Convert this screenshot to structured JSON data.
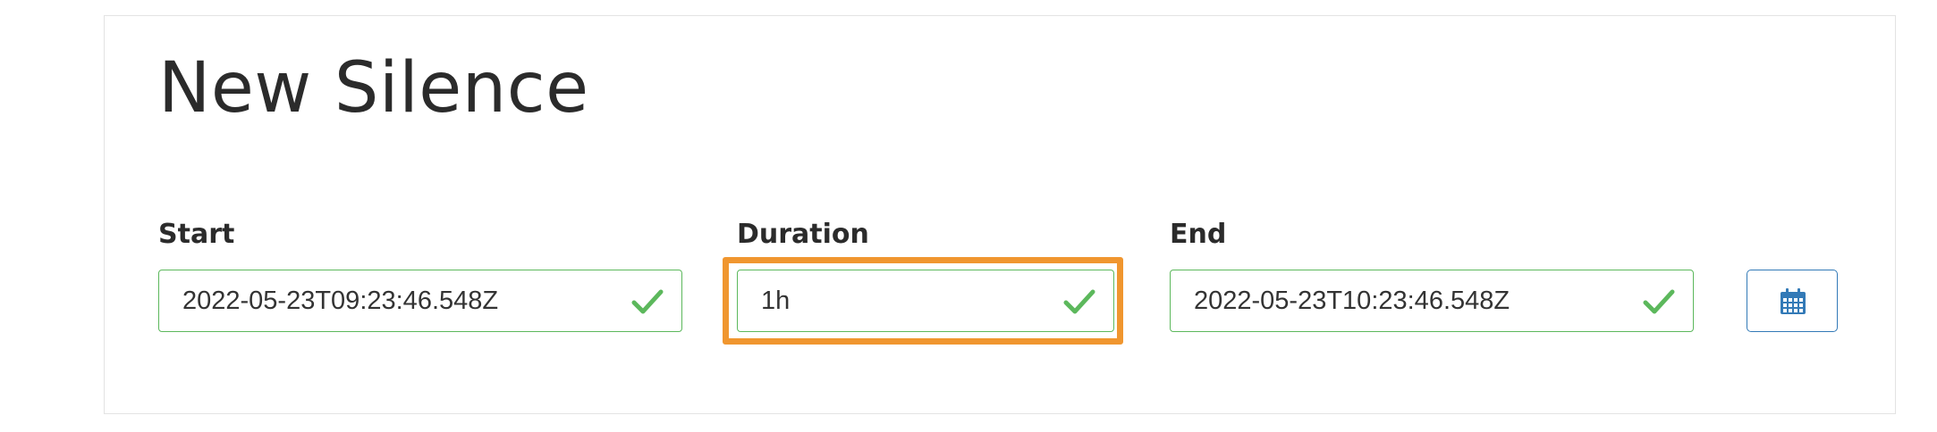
{
  "title": "New Silence",
  "fields": {
    "start": {
      "label": "Start",
      "value": "2022-05-23T09:23:46.548Z"
    },
    "duration": {
      "label": "Duration",
      "value": "1h"
    },
    "end": {
      "label": "End",
      "value": "2022-05-23T10:23:46.548Z"
    }
  },
  "icons": {
    "valid": "check-icon",
    "picker": "calendar-icon"
  },
  "colors": {
    "valid_border": "#5cb85c",
    "focus_outline": "#f0962f",
    "button_accent": "#337ab7",
    "text": "#2b2b2b"
  }
}
